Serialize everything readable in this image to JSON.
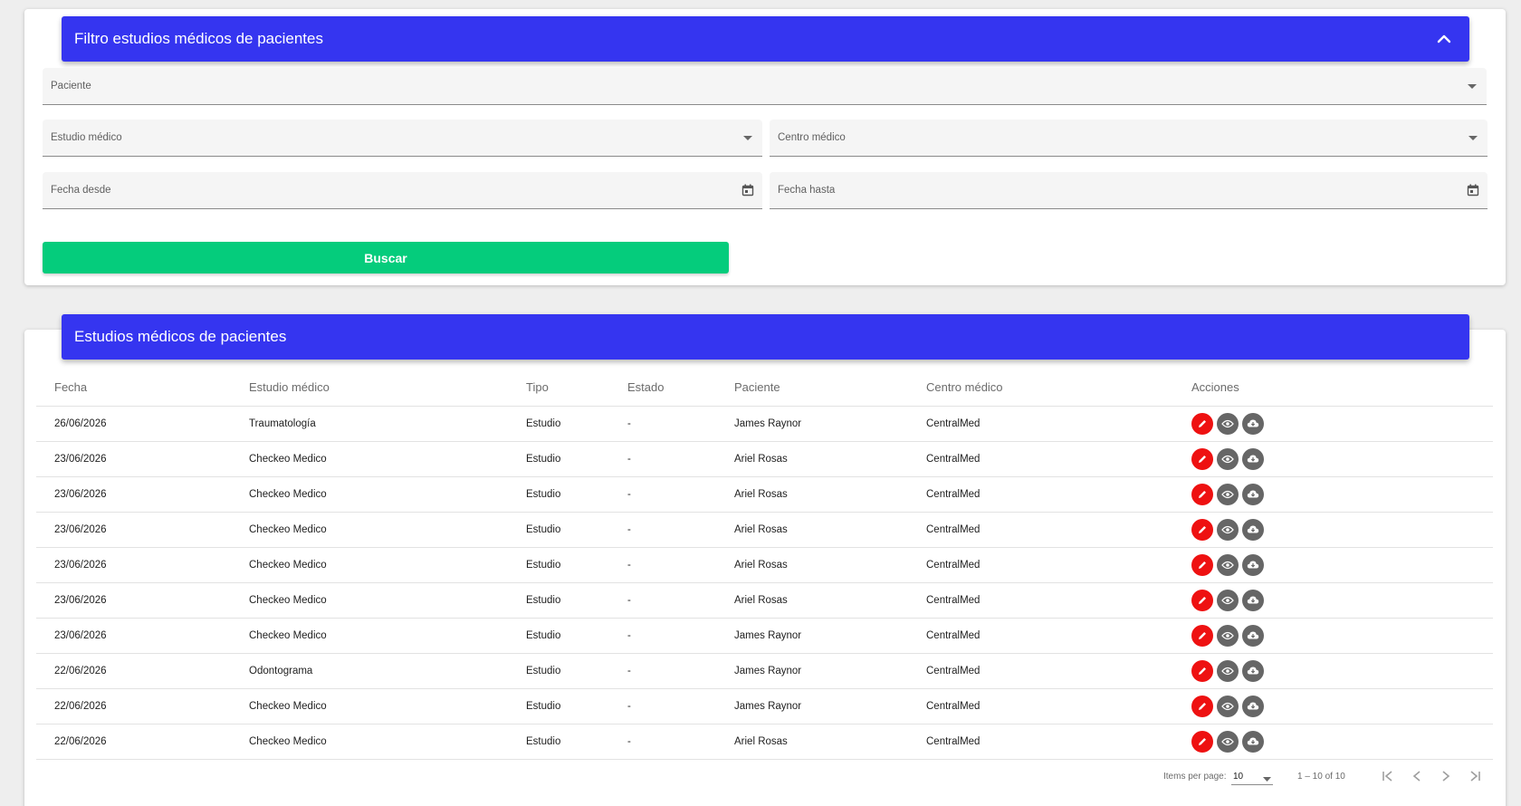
{
  "theme": {
    "accent": "#3535f0",
    "success": "#05cc7c",
    "edit_color": "#ee1111",
    "neutral_action": "#666666"
  },
  "filter": {
    "title": "Filtro estudios médicos de pacientes",
    "collapse_icon": "chevron-up-icon",
    "paciente_placeholder": "Paciente",
    "estudio_placeholder": "Estudio médico",
    "centro_placeholder": "Centro médico",
    "fecha_desde_placeholder": "Fecha desde",
    "fecha_hasta_placeholder": "Fecha hasta",
    "buscar_label": "Buscar"
  },
  "results": {
    "title": "Estudios médicos de pacientes",
    "columns": [
      "Fecha",
      "Estudio médico",
      "Tipo",
      "Estado",
      "Paciente",
      "Centro médico",
      "Acciones"
    ],
    "rows": [
      [
        "26/06/2026",
        "Traumatología",
        "Estudio",
        "-",
        "James Raynor",
        "CentralMed"
      ],
      [
        "23/06/2026",
        "Checkeo Medico",
        "Estudio",
        "-",
        "Ariel Rosas",
        "CentralMed"
      ],
      [
        "23/06/2026",
        "Checkeo Medico",
        "Estudio",
        "-",
        "Ariel Rosas",
        "CentralMed"
      ],
      [
        "23/06/2026",
        "Checkeo Medico",
        "Estudio",
        "-",
        "Ariel Rosas",
        "CentralMed"
      ],
      [
        "23/06/2026",
        "Checkeo Medico",
        "Estudio",
        "-",
        "Ariel Rosas",
        "CentralMed"
      ],
      [
        "23/06/2026",
        "Checkeo Medico",
        "Estudio",
        "-",
        "Ariel Rosas",
        "CentralMed"
      ],
      [
        "23/06/2026",
        "Checkeo Medico",
        "Estudio",
        "-",
        "James Raynor",
        "CentralMed"
      ],
      [
        "22/06/2026",
        "Odontograma",
        "Estudio",
        "-",
        "James Raynor",
        "CentralMed"
      ],
      [
        "22/06/2026",
        "Checkeo Medico",
        "Estudio",
        "-",
        "James Raynor",
        "CentralMed"
      ],
      [
        "22/06/2026",
        "Checkeo Medico",
        "Estudio",
        "-",
        "Ariel Rosas",
        "CentralMed"
      ]
    ],
    "action_icons": [
      "pencil-icon",
      "eye-icon",
      "cloud-download-icon"
    ]
  },
  "paginator": {
    "items_per_page_label": "Items per page:",
    "page_size": "10",
    "range_label": "1 – 10 of 10"
  }
}
